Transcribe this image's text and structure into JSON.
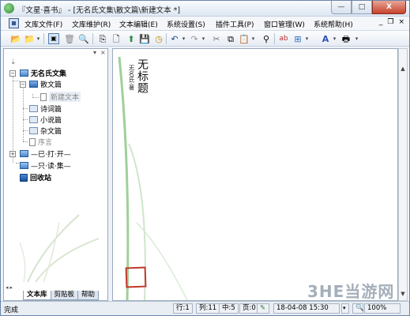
{
  "window": {
    "title": "『文星·喜书』 - [无名氏文集\\散文篇\\新建文本 *]",
    "btn_min": "—",
    "btn_max": "□",
    "btn_close": "X"
  },
  "menubar": {
    "items": [
      "文库文件(F)",
      "文库维护(R)",
      "文本编辑(E)",
      "系统设置(S)",
      "插件工具(P)",
      "窗口管理(W)",
      "系统帮助(H)"
    ],
    "mdi_min": "_",
    "mdi_restore": "❐",
    "mdi_close": "×"
  },
  "toolbar": {
    "icons": [
      "open-folder-icon",
      "folder-icon",
      "window-view-icon",
      "trash-icon",
      "print-preview-icon",
      "import-icon",
      "new-doc-icon",
      "export-icon",
      "save-icon",
      "clock-icon",
      "undo-icon",
      "redo-icon",
      "cut-icon",
      "copy-icon",
      "paste-icon",
      "find-icon",
      "replace-icon",
      "format-icon",
      "font-color-icon",
      "printer-icon"
    ]
  },
  "left_panel": {
    "tree": {
      "root_label": "无名氏文集",
      "node_prose": "散文篇",
      "node_new_text": "新建文本",
      "node_poetry": "诗词篇",
      "node_novel": "小说篇",
      "node_misc": "杂文篇",
      "node_preface": "序言",
      "node_one_done": "—已·打·开—",
      "node_one_read": "—只·读·集—",
      "node_recycle": "回收站"
    },
    "tabs": [
      "文本库",
      "剪贴板",
      "帮助"
    ]
  },
  "document": {
    "title": "无标题",
    "author": "无名氏·著",
    "seal_text": "文星喜书"
  },
  "statusbar": {
    "status": "完成",
    "row": "行:1",
    "col": "列:11",
    "chars": "中:5",
    "pages": "页:0",
    "datetime": "18-04-08 15:30",
    "zoom": "100%"
  },
  "watermark": "3HE当游网"
}
